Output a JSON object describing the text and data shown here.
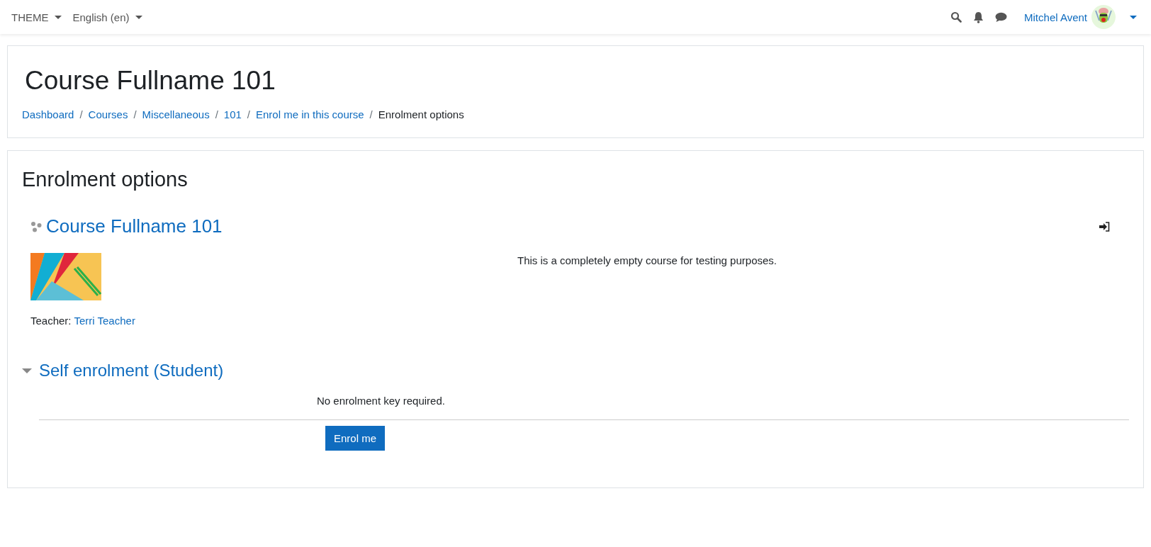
{
  "navbar": {
    "menus": [
      {
        "label": "THEME"
      },
      {
        "label": "English (en)"
      }
    ],
    "user": {
      "name": "Mitchel Avent"
    }
  },
  "header": {
    "title": "Course Fullname 101",
    "breadcrumb": {
      "separator": "/",
      "items": [
        {
          "label": "Dashboard",
          "link": true
        },
        {
          "label": "Courses",
          "link": true
        },
        {
          "label": "Miscellaneous",
          "link": true
        },
        {
          "label": "101",
          "link": true
        },
        {
          "label": "Enrol me in this course",
          "link": true
        },
        {
          "label": "Enrolment options",
          "link": false
        }
      ]
    }
  },
  "main": {
    "heading": "Enrolment options",
    "course": {
      "title": "Course Fullname 101",
      "summary": "This is a completely empty course for testing purposes.",
      "teacher_label": "Teacher:",
      "teacher_name": "Terri Teacher"
    },
    "enrolment": {
      "title": "Self enrolment (Student)",
      "expanded": true,
      "note": "No enrolment key required.",
      "button": "Enrol me"
    }
  }
}
